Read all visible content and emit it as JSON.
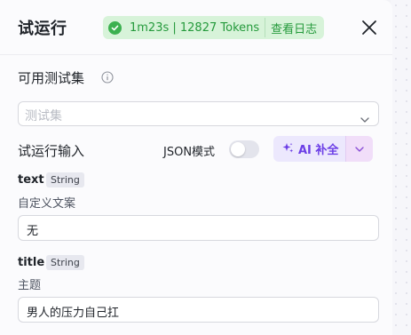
{
  "header": {
    "title": "试运行",
    "status": {
      "text": "1m23s | 12827 Tokens",
      "log_link": "查看日志",
      "color": "#3cb150"
    }
  },
  "testset": {
    "label": "可用测试集",
    "placeholder": "测试集"
  },
  "input_section": {
    "label": "试运行输入",
    "json_mode_label": "JSON模式",
    "json_mode_enabled": false,
    "ai_button_label": "AI 补全",
    "accent": "#6b3ee6"
  },
  "params": [
    {
      "name": "text",
      "type": "String",
      "description": "自定义文案",
      "value": "无"
    },
    {
      "name": "title",
      "type": "String",
      "description": "主题",
      "value": "男人的压力自己扛"
    }
  ]
}
